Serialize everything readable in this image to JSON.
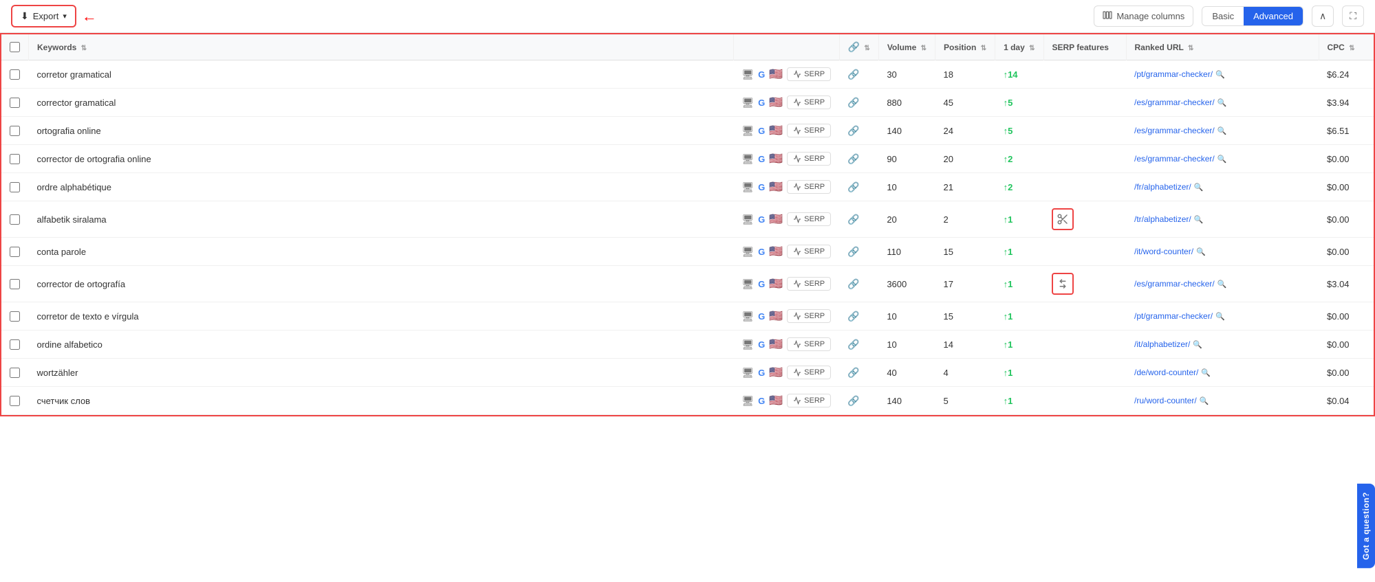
{
  "toolbar": {
    "export_label": "Export",
    "manage_columns_label": "Manage columns",
    "basic_label": "Basic",
    "advanced_label": "Advanced",
    "collapse_label": "^",
    "expand_label": "⛶"
  },
  "table": {
    "columns": {
      "keyword": "Keywords",
      "icons": "",
      "volume": "Volume",
      "position": "Position",
      "day1": "1 day",
      "serp_features": "SERP features",
      "ranked_url": "Ranked URL",
      "cpc": "CPC"
    },
    "rows": [
      {
        "keyword": "corretor gramatical",
        "volume": "30",
        "position": "18",
        "change": "↑14",
        "change_type": "up",
        "serp_feature_icon": "",
        "ranked_url": "/pt/grammar-checker/",
        "cpc": "$6.24"
      },
      {
        "keyword": "corrector gramatical",
        "volume": "880",
        "position": "45",
        "change": "↑5",
        "change_type": "up",
        "serp_feature_icon": "",
        "ranked_url": "/es/grammar-checker/",
        "cpc": "$3.94"
      },
      {
        "keyword": "ortografia online",
        "volume": "140",
        "position": "24",
        "change": "↑5",
        "change_type": "up",
        "serp_feature_icon": "",
        "ranked_url": "/es/grammar-checker/",
        "cpc": "$6.51"
      },
      {
        "keyword": "corrector de ortografia online",
        "volume": "90",
        "position": "20",
        "change": "↑2",
        "change_type": "up",
        "serp_feature_icon": "",
        "ranked_url": "/es/grammar-checker/",
        "cpc": "$0.00"
      },
      {
        "keyword": "ordre alphabétique",
        "volume": "10",
        "position": "21",
        "change": "↑2",
        "change_type": "up",
        "serp_feature_icon": "",
        "ranked_url": "/fr/alphabetizer/",
        "cpc": "$0.00"
      },
      {
        "keyword": "alfabetik siralama",
        "volume": "20",
        "position": "2",
        "change": "↑1",
        "change_type": "up",
        "serp_feature_icon": "scissors",
        "ranked_url": "/tr/alphabetizer/",
        "cpc": "$0.00"
      },
      {
        "keyword": "conta parole",
        "volume": "110",
        "position": "15",
        "change": "↑1",
        "change_type": "up",
        "serp_feature_icon": "",
        "ranked_url": "/it/word-counter/",
        "cpc": "$0.00"
      },
      {
        "keyword": "corrector de ortografía",
        "volume": "3600",
        "position": "17",
        "change": "↑1",
        "change_type": "up",
        "serp_feature_icon": "arrows",
        "ranked_url": "/es/grammar-checker/",
        "cpc": "$3.04"
      },
      {
        "keyword": "corretor de texto e vírgula",
        "volume": "10",
        "position": "15",
        "change": "↑1",
        "change_type": "up",
        "serp_feature_icon": "",
        "ranked_url": "/pt/grammar-checker/",
        "cpc": "$0.00"
      },
      {
        "keyword": "ordine alfabetico",
        "volume": "10",
        "position": "14",
        "change": "↑1",
        "change_type": "up",
        "serp_feature_icon": "",
        "ranked_url": "/it/alphabetizer/",
        "cpc": "$0.00"
      },
      {
        "keyword": "wortzähler",
        "volume": "40",
        "position": "4",
        "change": "↑1",
        "change_type": "up",
        "serp_feature_icon": "",
        "ranked_url": "/de/word-counter/",
        "cpc": "$0.00"
      },
      {
        "keyword": "счетчик слов",
        "volume": "140",
        "position": "5",
        "change": "↑1",
        "change_type": "up",
        "serp_feature_icon": "",
        "ranked_url": "/ru/word-counter/",
        "cpc": "$0.04"
      }
    ]
  },
  "chat_widget": {
    "label": "Got a question?"
  }
}
